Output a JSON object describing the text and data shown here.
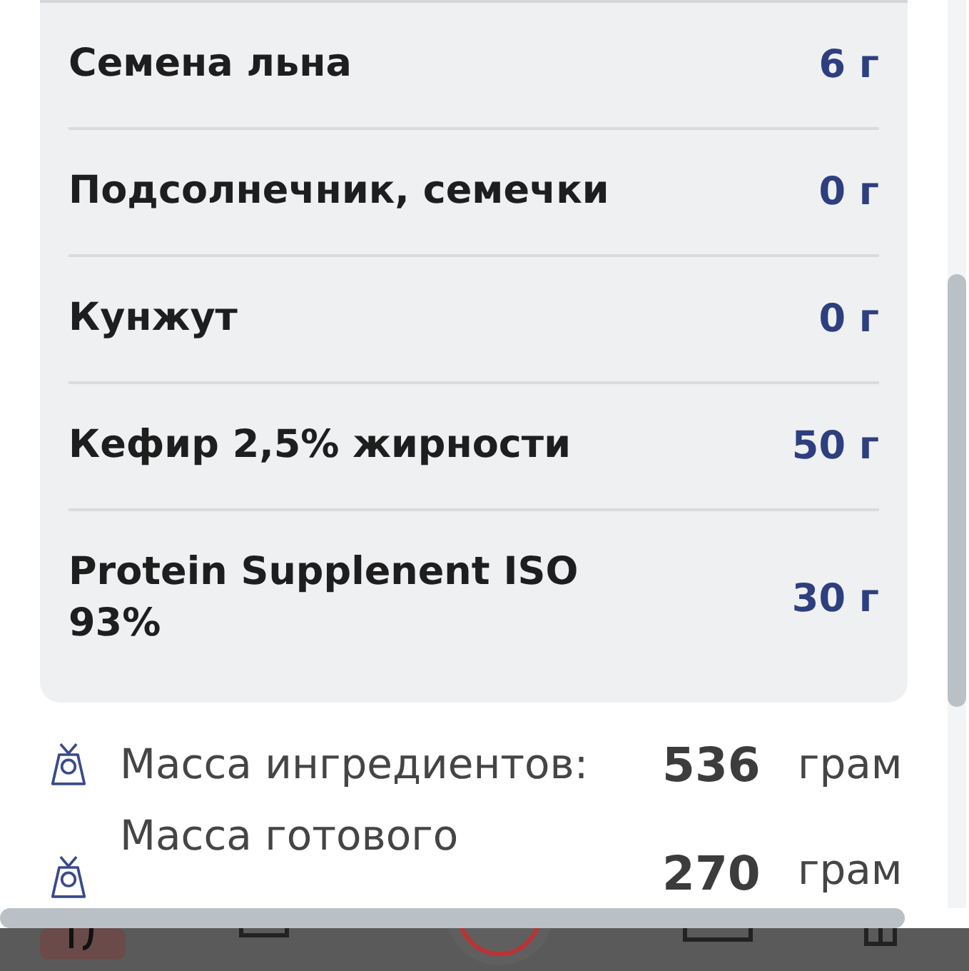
{
  "ingredients": [
    {
      "name": "Семена льна",
      "amount": "6 г"
    },
    {
      "name": "Подсолнечник, семечки",
      "amount": "0 г"
    },
    {
      "name": "Кунжут",
      "amount": "0 г"
    },
    {
      "name": "Кефир 2,5% жирности",
      "amount": "50 г"
    },
    {
      "name": "Protein Supplenent ISO 93%",
      "amount": "30 г"
    }
  ],
  "summary": [
    {
      "label": "Масса ингредиентов:",
      "value": "536",
      "unit": "грам"
    },
    {
      "label": "Масса готового",
      "value": "270",
      "unit": "грам"
    }
  ]
}
